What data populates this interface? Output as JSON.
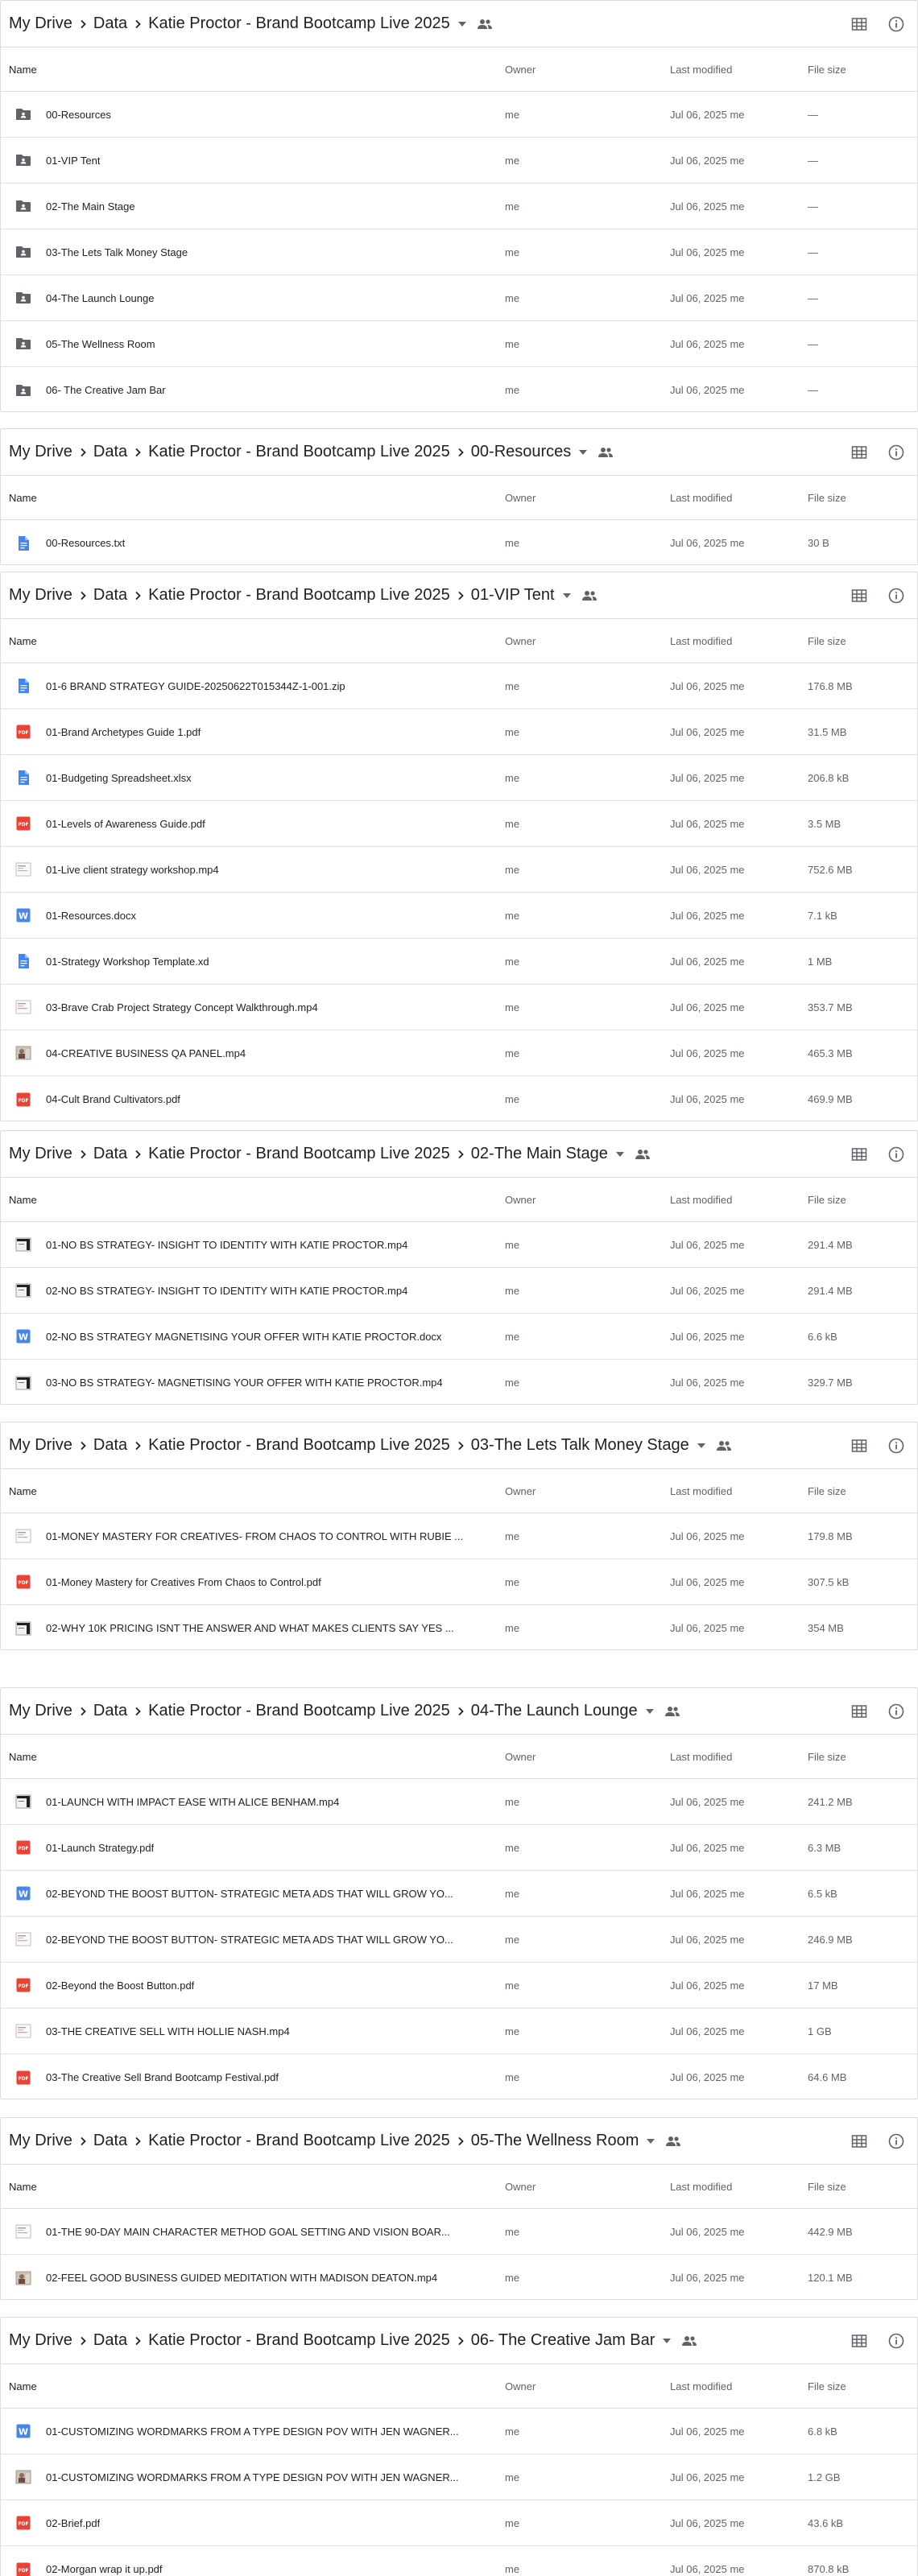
{
  "icons": {
    "chevron": "chevron-right-icon",
    "dropdown": "arrow-drop-down-icon",
    "shared": "people-icon",
    "grid": "grid-view-icon",
    "info": "info-icon"
  },
  "columns": {
    "name": "Name",
    "owner": "Owner",
    "modified": "Last modified",
    "size": "File size"
  },
  "panels": [
    {
      "crumbs": [
        "My Drive",
        "Data",
        "Katie Proctor - Brand Bootcamp Live 2025"
      ],
      "rows": [
        {
          "name": "00-Resources",
          "type": "folder",
          "owner": "me",
          "modified": "Jul 06, 2025 me",
          "size": "—"
        },
        {
          "name": "01-VIP Tent",
          "type": "folder",
          "owner": "me",
          "modified": "Jul 06, 2025 me",
          "size": "—"
        },
        {
          "name": "02-The Main Stage",
          "type": "folder",
          "owner": "me",
          "modified": "Jul 06, 2025 me",
          "size": "—"
        },
        {
          "name": "03-The Lets Talk Money Stage",
          "type": "folder",
          "owner": "me",
          "modified": "Jul 06, 2025 me",
          "size": "—"
        },
        {
          "name": "04-The Launch Lounge",
          "type": "folder",
          "owner": "me",
          "modified": "Jul 06, 2025 me",
          "size": "—"
        },
        {
          "name": "05-The Wellness Room",
          "type": "folder",
          "owner": "me",
          "modified": "Jul 06, 2025 me",
          "size": "—"
        },
        {
          "name": "06- The Creative Jam Bar",
          "type": "folder",
          "owner": "me",
          "modified": "Jul 06, 2025 me",
          "size": "—"
        }
      ]
    },
    {
      "crumbs": [
        "My Drive",
        "Data",
        "Katie Proctor - Brand Bootcamp Live 2025",
        "00-Resources"
      ],
      "rows": [
        {
          "name": "00-Resources.txt",
          "type": "doc",
          "owner": "me",
          "modified": "Jul 06, 2025 me",
          "size": "30 B"
        }
      ]
    },
    {
      "crumbs": [
        "My Drive",
        "Data",
        "Katie Proctor - Brand Bootcamp Live 2025",
        "01-VIP Tent"
      ],
      "rows": [
        {
          "name": "01-6 BRAND STRATEGY GUIDE-20250622T015344Z-1-001.zip",
          "type": "doc",
          "owner": "me",
          "modified": "Jul 06, 2025 me",
          "size": "176.8 MB"
        },
        {
          "name": "01-Brand Archetypes Guide 1.pdf",
          "type": "pdf",
          "owner": "me",
          "modified": "Jul 06, 2025 me",
          "size": "31.5 MB"
        },
        {
          "name": "01-Budgeting Spreadsheet.xlsx",
          "type": "doc",
          "owner": "me",
          "modified": "Jul 06, 2025 me",
          "size": "206.8 kB"
        },
        {
          "name": "01-Levels of Awareness Guide.pdf",
          "type": "pdf",
          "owner": "me",
          "modified": "Jul 06, 2025 me",
          "size": "3.5 MB"
        },
        {
          "name": "01-Live client strategy workshop.mp4",
          "type": "video-light",
          "owner": "me",
          "modified": "Jul 06, 2025 me",
          "size": "752.6 MB"
        },
        {
          "name": "01-Resources.docx",
          "type": "word",
          "owner": "me",
          "modified": "Jul 06, 2025 me",
          "size": "7.1 kB"
        },
        {
          "name": "01-Strategy Workshop Template.xd",
          "type": "doc",
          "owner": "me",
          "modified": "Jul 06, 2025 me",
          "size": "1 MB"
        },
        {
          "name": "03-Brave Crab Project Strategy Concept Walkthrough.mp4",
          "type": "video-light",
          "owner": "me",
          "modified": "Jul 06, 2025 me",
          "size": "353.7 MB"
        },
        {
          "name": "04-CREATIVE BUSINESS QA PANEL.mp4",
          "type": "video-photo",
          "owner": "me",
          "modified": "Jul 06, 2025 me",
          "size": "465.3 MB"
        },
        {
          "name": "04-Cult Brand Cultivators.pdf",
          "type": "pdf",
          "owner": "me",
          "modified": "Jul 06, 2025 me",
          "size": "469.9 MB"
        }
      ]
    },
    {
      "crumbs": [
        "My Drive",
        "Data",
        "Katie Proctor - Brand Bootcamp Live 2025",
        "02-The Main Stage"
      ],
      "rows": [
        {
          "name": "01-NO BS STRATEGY- INSIGHT TO IDENTITY WITH KATIE PROCTOR.mp4",
          "type": "video-dark",
          "owner": "me",
          "modified": "Jul 06, 2025 me",
          "size": "291.4 MB"
        },
        {
          "name": "02-NO BS STRATEGY- INSIGHT TO IDENTITY WITH KATIE PROCTOR.mp4",
          "type": "video-dark",
          "owner": "me",
          "modified": "Jul 06, 2025 me",
          "size": "291.4 MB"
        },
        {
          "name": "02-NO BS STRATEGY MAGNETISING YOUR OFFER WITH KATIE PROCTOR.docx",
          "type": "word",
          "owner": "me",
          "modified": "Jul 06, 2025 me",
          "size": "6.6 kB"
        },
        {
          "name": "03-NO BS STRATEGY- MAGNETISING YOUR OFFER WITH KATIE PROCTOR.mp4",
          "type": "video-dark",
          "owner": "me",
          "modified": "Jul 06, 2025 me",
          "size": "329.7 MB"
        }
      ]
    },
    {
      "crumbs": [
        "My Drive",
        "Data",
        "Katie Proctor - Brand Bootcamp Live 2025",
        "03-The Lets Talk Money Stage"
      ],
      "rows": [
        {
          "name": "01-MONEY MASTERY FOR CREATIVES- FROM CHAOS TO CONTROL WITH RUBIE ...",
          "type": "video-light",
          "owner": "me",
          "modified": "Jul 06, 2025 me",
          "size": "179.8 MB"
        },
        {
          "name": "01-Money Mastery for Creatives From Chaos to Control.pdf",
          "type": "pdf",
          "owner": "me",
          "modified": "Jul 06, 2025 me",
          "size": "307.5 kB"
        },
        {
          "name": "02-WHY 10K PRICING ISNT THE ANSWER AND WHAT MAKES CLIENTS SAY YES ...",
          "type": "video-dark",
          "owner": "me",
          "modified": "Jul 06, 2025 me",
          "size": "354 MB"
        }
      ]
    },
    {
      "crumbs": [
        "My Drive",
        "Data",
        "Katie Proctor - Brand Bootcamp Live 2025",
        "04-The Launch Lounge"
      ],
      "rows": [
        {
          "name": "01-LAUNCH WITH IMPACT EASE WITH ALICE BENHAM.mp4",
          "type": "video-dark",
          "owner": "me",
          "modified": "Jul 06, 2025 me",
          "size": "241.2 MB"
        },
        {
          "name": "01-Launch Strategy.pdf",
          "type": "pdf",
          "owner": "me",
          "modified": "Jul 06, 2025 me",
          "size": "6.3 MB"
        },
        {
          "name": "02-BEYOND THE BOOST BUTTON- STRATEGIC META ADS THAT WILL GROW YO...",
          "type": "word",
          "owner": "me",
          "modified": "Jul 06, 2025 me",
          "size": "6.5 kB"
        },
        {
          "name": "02-BEYOND THE BOOST BUTTON- STRATEGIC META ADS THAT WILL GROW YO...",
          "type": "video-light",
          "owner": "me",
          "modified": "Jul 06, 2025 me",
          "size": "246.9 MB"
        },
        {
          "name": "02-Beyond the Boost Button.pdf",
          "type": "pdf",
          "owner": "me",
          "modified": "Jul 06, 2025 me",
          "size": "17 MB"
        },
        {
          "name": "03-THE CREATIVE SELL WITH HOLLIE NASH.mp4",
          "type": "video-light",
          "owner": "me",
          "modified": "Jul 06, 2025 me",
          "size": "1 GB"
        },
        {
          "name": "03-The Creative Sell Brand Bootcamp Festival.pdf",
          "type": "pdf",
          "owner": "me",
          "modified": "Jul 06, 2025 me",
          "size": "64.6 MB"
        }
      ]
    },
    {
      "crumbs": [
        "My Drive",
        "Data",
        "Katie Proctor - Brand Bootcamp Live 2025",
        "05-The Wellness Room"
      ],
      "rows": [
        {
          "name": "01-THE 90-DAY MAIN CHARACTER METHOD GOAL SETTING AND VISION BOAR...",
          "type": "video-light",
          "owner": "me",
          "modified": "Jul 06, 2025 me",
          "size": "442.9 MB"
        },
        {
          "name": "02-FEEL GOOD BUSINESS GUIDED MEDITATION WITH MADISON DEATON.mp4",
          "type": "video-photo",
          "owner": "me",
          "modified": "Jul 06, 2025 me",
          "size": "120.1 MB"
        }
      ]
    },
    {
      "crumbs": [
        "My Drive",
        "Data",
        "Katie Proctor - Brand Bootcamp Live 2025",
        "06- The Creative Jam Bar"
      ],
      "rows": [
        {
          "name": "01-CUSTOMIZING WORDMARKS FROM A TYPE DESIGN POV WITH JEN WAGNER...",
          "type": "word",
          "owner": "me",
          "modified": "Jul 06, 2025 me",
          "size": "6.8 kB"
        },
        {
          "name": "01-CUSTOMIZING WORDMARKS FROM A TYPE DESIGN POV WITH JEN WAGNER...",
          "type": "video-photo",
          "owner": "me",
          "modified": "Jul 06, 2025 me",
          "size": "1.2 GB"
        },
        {
          "name": "02-Brief.pdf",
          "type": "pdf",
          "owner": "me",
          "modified": "Jul 06, 2025 me",
          "size": "43.6 kB"
        },
        {
          "name": "02-Morgan wrap it up.pdf",
          "type": "pdf",
          "owner": "me",
          "modified": "Jul 06, 2025 me",
          "size": "870.8 kB"
        }
      ]
    }
  ]
}
